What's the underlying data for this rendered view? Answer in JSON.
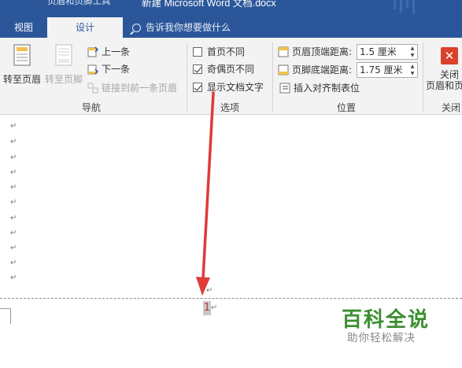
{
  "title_bar": {
    "context_tab_title": "页眉和页脚工具",
    "document_title": "新建 Microsoft Word 文档.docx"
  },
  "tabs": {
    "view": "视图",
    "design": "设计"
  },
  "tell_me": {
    "placeholder": "告诉我你想要做什么",
    "icon": "search-icon"
  },
  "ribbon": {
    "navigation": {
      "group_label": "导航",
      "goto_header": "转至页眉",
      "goto_footer": "转至页脚",
      "previous": "上一条",
      "next": "下一条",
      "link_to_previous": "链接到前一条页眉"
    },
    "options": {
      "group_label": "选项",
      "different_first_page": {
        "label": "首页不同",
        "checked": false
      },
      "different_odd_even": {
        "label": "奇偶页不同",
        "checked": true
      },
      "show_document_text": {
        "label": "显示文档文字",
        "checked": true
      }
    },
    "position": {
      "group_label": "位置",
      "header_from_top_label": "页眉顶端距离:",
      "header_from_top_value": "1.5 厘米",
      "footer_from_bottom_label": "页脚底端距离:",
      "footer_from_bottom_value": "1.75 厘米",
      "insert_alignment_tab": "插入对齐制表位"
    },
    "close": {
      "group_label": "关闭",
      "button_line1": "关闭",
      "button_line2": "页眉和页脚"
    }
  },
  "document": {
    "paragraph_mark": "↵",
    "page_number": "1"
  },
  "watermark": {
    "title": "百科全说",
    "subtitle": "助你轻松解决"
  },
  "colors": {
    "title_bar": "#2b579a",
    "ribbon_bg": "#f3f3f3",
    "close_red": "#d9432b",
    "annotation_arrow": "#e03a3a",
    "watermark_green": "#3a8f2f"
  }
}
